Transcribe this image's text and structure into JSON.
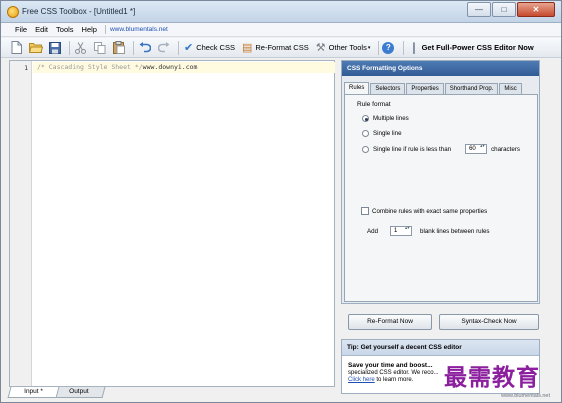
{
  "window": {
    "title": "Free CSS Toolbox - [Untitled1 *]",
    "controls": {
      "minimize": "—",
      "maximize": "□",
      "close": "✕"
    }
  },
  "menu": {
    "items": [
      "File",
      "Edit",
      "Tools",
      "Help"
    ],
    "link": "www.blumentals.net"
  },
  "toolbar": {
    "icons": [
      "new-file",
      "open-folder",
      "save",
      "cut",
      "copy",
      "paste",
      "undo",
      "redo"
    ],
    "check_label": "Check CSS",
    "reformat_label": "Re-Format CSS",
    "tools_label": "Other Tools",
    "editor_label": "Get Full-Power CSS Editor Now"
  },
  "editor": {
    "line_number": "1",
    "comment_text": "/* Cascading Style Sheet */",
    "url_text": "www.downyi.com",
    "tabs": [
      "Input *",
      "Output"
    ]
  },
  "panel": {
    "title": "CSS Formatting Options",
    "tabs": [
      "Rules",
      "Selectors",
      "Properties",
      "Shorthand Prop.",
      "Misc"
    ],
    "active_tab": "Rules",
    "rule_format_label": "Rule format",
    "options": {
      "multiple": "Multiple lines",
      "single": "Single line",
      "single_if_before": "Single line if rule is less than",
      "chars_value": "60",
      "chars_after": "characters"
    },
    "selected_option": "Multiple lines",
    "combine_label": "Combine rules with exact same properties",
    "combine_checked": false,
    "add_label": "Add",
    "blank_value": "1",
    "blank_label": "blank lines between rules"
  },
  "actions": {
    "reformat": "Re-Format Now",
    "syntax_check": "Syntax-Check Now"
  },
  "tip": {
    "header": "Tip: Get yourself a decent CSS editor",
    "title": "Save your time and boost...",
    "line2": "specialized CSS editor. We reco...",
    "link": "Click here",
    "line3_rest": " to learn more."
  },
  "watermark": "最需教育",
  "status": {
    "url": "www.blumentals.net"
  },
  "colors": {
    "panel_header": "#315b94",
    "link": "#1f4fb4",
    "watermark": "#8b1f9e"
  }
}
